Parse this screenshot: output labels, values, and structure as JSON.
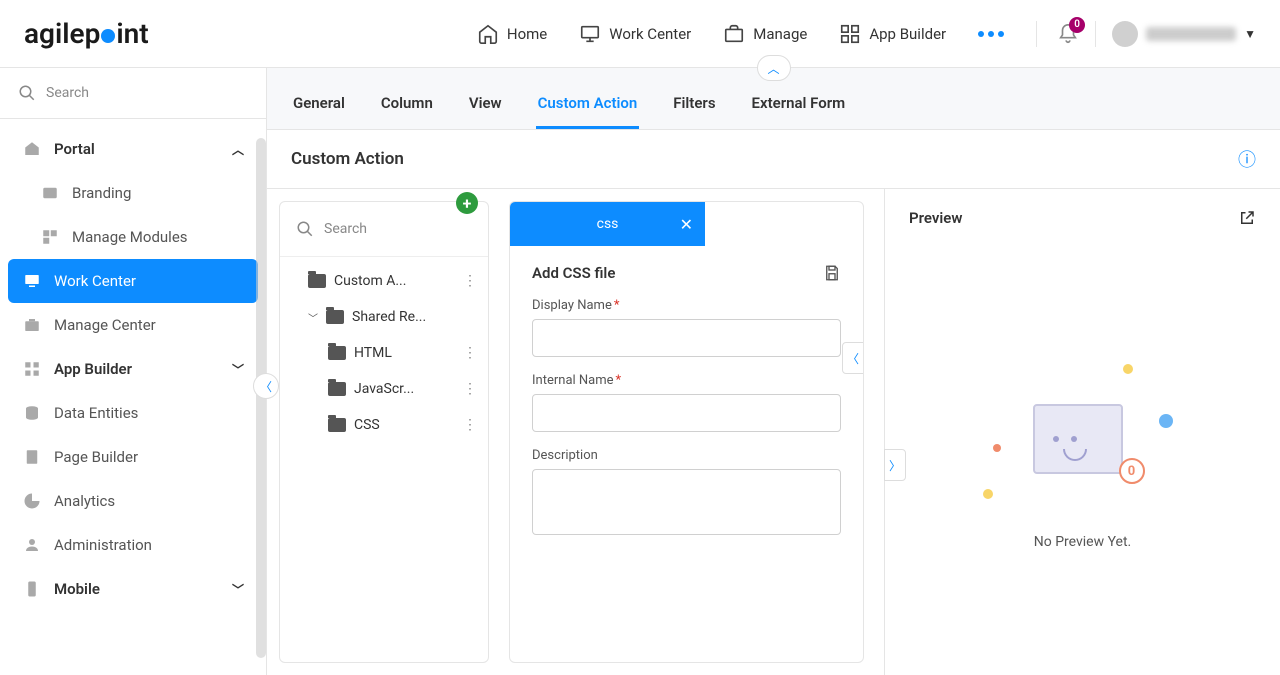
{
  "header": {
    "logo_prefix": "agilep",
    "logo_suffix": "int",
    "nav": [
      {
        "label": "Home"
      },
      {
        "label": "Work Center"
      },
      {
        "label": "Manage"
      },
      {
        "label": "App Builder"
      }
    ],
    "notification_count": "0"
  },
  "sidebar": {
    "search_placeholder": "Search",
    "items": [
      {
        "label": "Portal",
        "bold": true,
        "expandable": "up"
      },
      {
        "label": "Branding",
        "sub": true
      },
      {
        "label": "Manage Modules",
        "sub": true
      },
      {
        "label": "Work Center",
        "active": true
      },
      {
        "label": "Manage Center"
      },
      {
        "label": "App Builder",
        "bold": true,
        "expandable": "down"
      },
      {
        "label": "Data Entities"
      },
      {
        "label": "Page Builder"
      },
      {
        "label": "Analytics"
      },
      {
        "label": "Administration"
      },
      {
        "label": "Mobile",
        "bold": true,
        "expandable": "down"
      }
    ]
  },
  "tabs": {
    "items": [
      {
        "label": "General"
      },
      {
        "label": "Column"
      },
      {
        "label": "View"
      },
      {
        "label": "Custom Action",
        "active": true
      },
      {
        "label": "Filters"
      },
      {
        "label": "External Form"
      }
    ]
  },
  "page": {
    "title": "Custom Action"
  },
  "tree": {
    "search_placeholder": "Search",
    "items": [
      {
        "label": "Custom A...",
        "indent": 1,
        "chev": false,
        "menu": true
      },
      {
        "label": "Shared Re...",
        "indent": 1,
        "chev": true,
        "menu": false
      },
      {
        "label": "HTML",
        "indent": 2,
        "chev": false,
        "menu": true
      },
      {
        "label": "JavaScr...",
        "indent": 2,
        "chev": false,
        "menu": true
      },
      {
        "label": "CSS",
        "indent": 2,
        "chev": false,
        "menu": true
      }
    ]
  },
  "form": {
    "tab_label": "css",
    "title": "Add CSS file",
    "fields": {
      "display_name": {
        "label": "Display Name",
        "required": true,
        "value": ""
      },
      "internal_name": {
        "label": "Internal Name",
        "required": true,
        "value": ""
      },
      "description": {
        "label": "Description",
        "required": false,
        "value": ""
      }
    }
  },
  "preview": {
    "title": "Preview",
    "empty_text": "No Preview Yet.",
    "badge": "0"
  }
}
